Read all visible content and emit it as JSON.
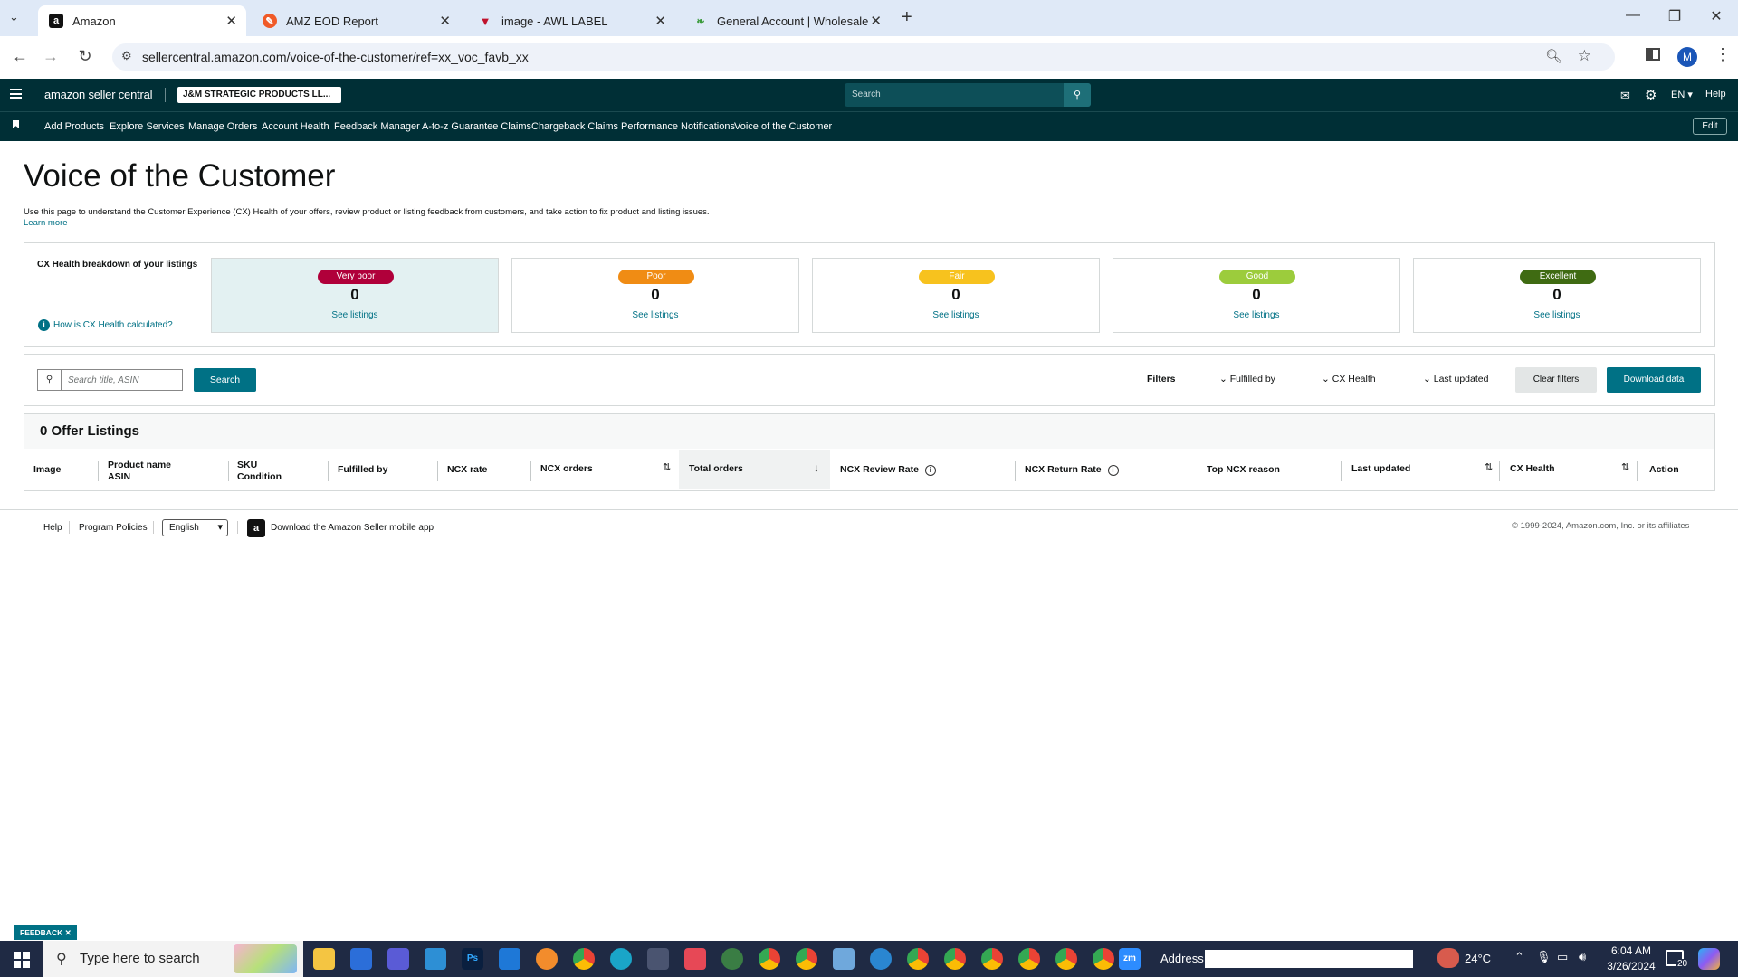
{
  "browser": {
    "tabs": [
      {
        "title": "Amazon",
        "active": true
      },
      {
        "title": "AMZ EOD Report",
        "active": false
      },
      {
        "title": "image - AWL LABEL",
        "active": false
      },
      {
        "title": "General Account | Wholesale",
        "active": false
      }
    ],
    "url": "sellercentral.amazon.com/voice-of-the-customer/ref=xx_voc_favb_xx",
    "profile_initial": "M"
  },
  "header": {
    "logo": "amazon seller central",
    "account": "J&M STRATEGIC PRODUCTS LL...",
    "search_placeholder": "Search",
    "lang": "EN",
    "help": "Help"
  },
  "nav": {
    "items": [
      "Add Products",
      "Explore Services",
      "Manage Orders",
      "Account Health",
      "Feedback Manager",
      "A-to-z Guarantee Claims",
      "Chargeback Claims",
      "Performance Notifications",
      "Voice of the Customer"
    ],
    "edit": "Edit"
  },
  "page": {
    "title": "Voice of the Customer",
    "description": "Use this page to understand the Customer Experience (CX) Health of your offers, review product or listing feedback from customers, and take action to fix product and listing issues.",
    "learn_more": "Learn more"
  },
  "health": {
    "heading": "CX Health breakdown of your listings",
    "how_link": "How is CX Health calculated?",
    "buckets": [
      {
        "label": "Very poor",
        "count": "0",
        "link": "See listings",
        "color": "#b0003a"
      },
      {
        "label": "Poor",
        "count": "0",
        "link": "See listings",
        "color": "#f08c14"
      },
      {
        "label": "Fair",
        "count": "0",
        "link": "See listings",
        "color": "#f7c21e"
      },
      {
        "label": "Good",
        "count": "0",
        "link": "See listings",
        "color": "#9ccc3c"
      },
      {
        "label": "Excellent",
        "count": "0",
        "link": "See listings",
        "color": "#3f6b12"
      }
    ]
  },
  "search": {
    "placeholder": "Search title, ASIN",
    "button": "Search",
    "filters_label": "Filters",
    "filters": [
      "Fulfilled by",
      "CX Health",
      "Last updated"
    ],
    "clear": "Clear filters",
    "download": "Download data"
  },
  "listings": {
    "count_title": "0 Offer Listings",
    "columns": [
      {
        "line1": "Image",
        "line2": ""
      },
      {
        "line1": "Product name",
        "line2": "ASIN"
      },
      {
        "line1": "SKU",
        "line2": "Condition"
      },
      {
        "line1": "Fulfilled by",
        "line2": ""
      },
      {
        "line1": "NCX rate",
        "line2": ""
      },
      {
        "line1": "NCX orders",
        "line2": ""
      },
      {
        "line1": "Total orders",
        "line2": ""
      },
      {
        "line1": "NCX Review Rate",
        "line2": ""
      },
      {
        "line1": "NCX Return Rate",
        "line2": ""
      },
      {
        "line1": "Top NCX reason",
        "line2": ""
      },
      {
        "line1": "Last updated",
        "line2": ""
      },
      {
        "line1": "CX Health",
        "line2": ""
      },
      {
        "line1": "Action",
        "line2": ""
      }
    ]
  },
  "footer": {
    "help": "Help",
    "policies": "Program Policies",
    "language": "English",
    "app": "Download the Amazon Seller mobile app",
    "copyright": "© 1999-2024, Amazon.com, Inc. or its affiliates"
  },
  "feedback_tab": "FEEDBACK",
  "taskbar": {
    "search_placeholder": "Type here to search",
    "address_label": "Address",
    "temperature": "24°C",
    "time": "6:04 AM",
    "date": "3/26/2024",
    "notifications": "20"
  }
}
